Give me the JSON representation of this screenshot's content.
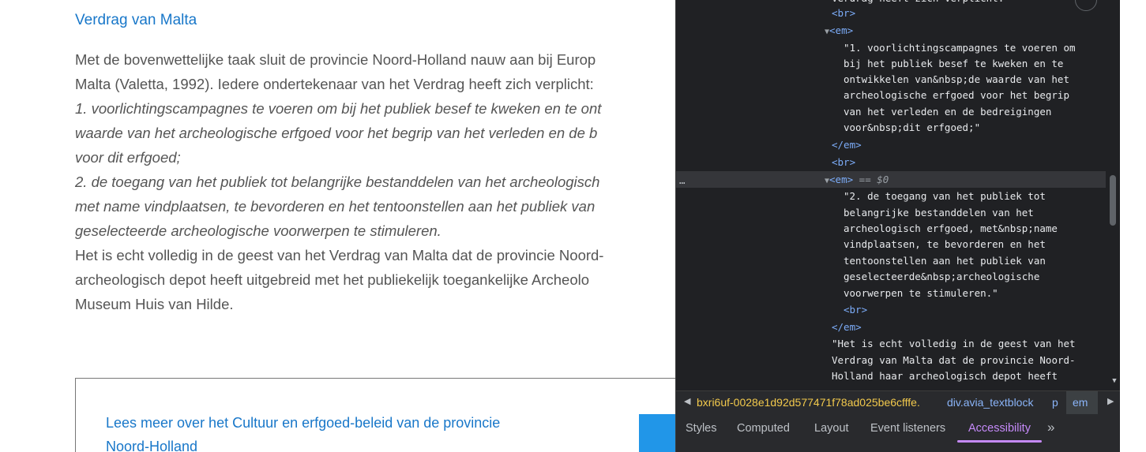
{
  "page": {
    "title": "Verdrag van Malta",
    "lines": [
      "Met de bovenwettelijke taak sluit de provincie Noord-Holland nauw aan bij Europ",
      "Malta (Valetta, 1992). Iedere ondertekenaar van het Verdrag heeft zich verplicht:",
      "1. voorlichtingscampagnes te voeren om bij het publiek besef te kweken en te ont",
      "waarde van het archeologische erfgoed voor het begrip van het verleden en de b",
      "voor dit erfgoed;",
      "2. de toegang van het publiek tot belangrijke bestanddelen van het archeologisch",
      "met name vindplaatsen, te bevorderen en het tentoonstellen aan het publiek van",
      "geselecteerde archeologische voorwerpen te stimuleren.",
      "Het is echt volledig in de geest van het Verdrag van Malta dat de provincie Noord-",
      "archeologisch depot heeft uitgebreid met het publiekelijk toegankelijke Archeolo",
      "Museum Huis van Hilde."
    ],
    "box_link_lines": [
      "Lees meer over het Cultuur en erfgoed-beleid van de provincie",
      "Noord-Holland"
    ]
  },
  "devtools": {
    "code": [
      {
        "type": "text",
        "text": "Verdrag heeft zich verplicht:"
      },
      {
        "type": "tag",
        "text": "<br>"
      },
      {
        "type": "tag",
        "text": "<em>"
      },
      {
        "type": "text",
        "text": "\"1. voorlichtingscampagnes te voeren om"
      },
      {
        "type": "text",
        "text": "bij het publiek besef te kweken en te"
      },
      {
        "type": "text",
        "text": "ontwikkelen van&nbsp;de waarde van het"
      },
      {
        "type": "text",
        "text": "archeologische erfgoed voor het begrip"
      },
      {
        "type": "text",
        "text": "van het verleden en de bedreigingen"
      },
      {
        "type": "text",
        "text": "voor&nbsp;dit erfgoed;\""
      },
      {
        "type": "tag",
        "text": "</em>"
      },
      {
        "type": "tag",
        "text": "<br>"
      },
      {
        "type": "tag",
        "text": "<em>"
      },
      {
        "type": "text",
        "text": "\"2. de toegang van het publiek tot"
      },
      {
        "type": "text",
        "text": "belangrijke bestanddelen van het"
      },
      {
        "type": "text",
        "text": "archeologisch erfgoed, met&nbsp;name"
      },
      {
        "type": "text",
        "text": "vindplaatsen, te bevorderen en het"
      },
      {
        "type": "text",
        "text": "tentoonstellen aan het publiek van"
      },
      {
        "type": "text",
        "text": "geselecteerde&nbsp;archeologische"
      },
      {
        "type": "text",
        "text": "voorwerpen te stimuleren.\""
      },
      {
        "type": "tag",
        "text": "<br>"
      },
      {
        "type": "tag",
        "text": "</em>"
      },
      {
        "type": "text",
        "text": "\"Het is echt volledig in de geest van het"
      },
      {
        "type": "text",
        "text": "Verdrag van Malta dat de provincie Noord-"
      },
      {
        "type": "text",
        "text": "Holland haar archeologisch depot heeft"
      }
    ],
    "selected_suffix": "== $0",
    "dots": "…",
    "breadcrumbs": {
      "hash": "bxri6uf-0028e1d92d577471f78ad025be6cfffe.",
      "div": "div.avia_textblock",
      "p": "p",
      "em": "em"
    },
    "tabs": [
      "Styles",
      "Computed",
      "Layout",
      "Event listeners",
      "Accessibility"
    ],
    "more_tabs": "»",
    "colors": {
      "tag": "#7cacf8",
      "active_tab": "#c58af9",
      "link": "#1877c9"
    }
  }
}
